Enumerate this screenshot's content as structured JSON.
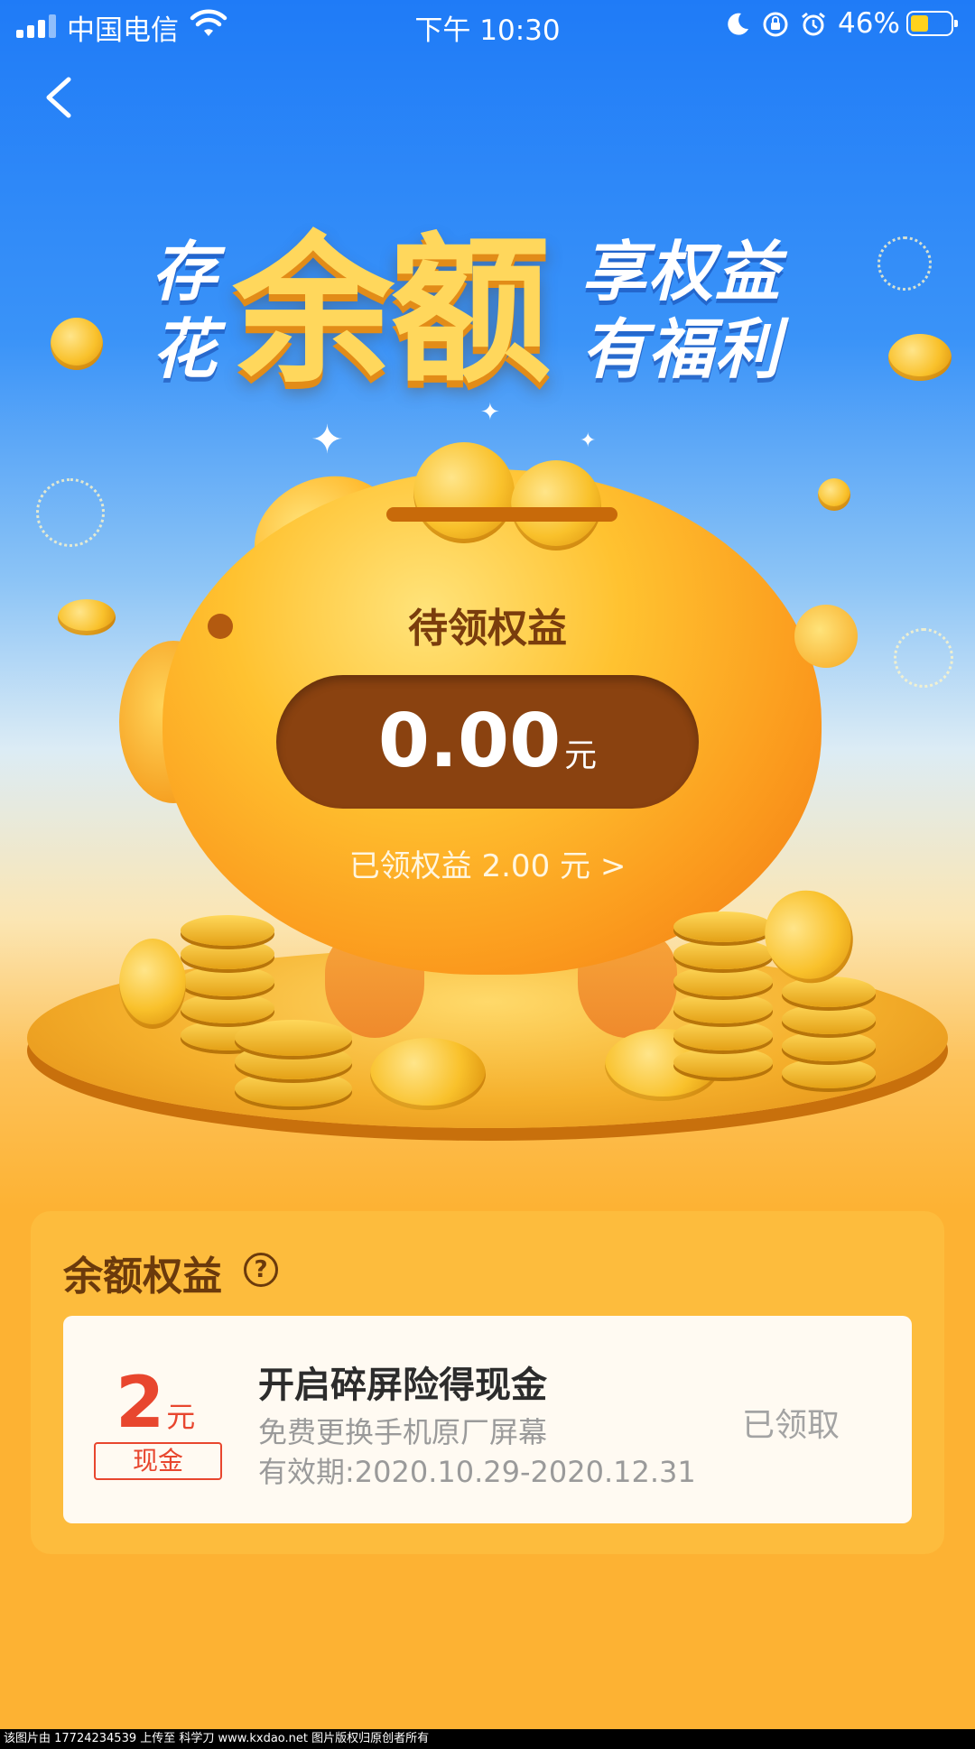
{
  "status_bar": {
    "carrier": "中国电信",
    "time": "下午 10:30",
    "battery_percent": "46%",
    "battery_level": 0.46,
    "battery_color": "#ffd21d",
    "icons": [
      "signal-icon",
      "wifi-icon",
      "moon-icon",
      "orientation-lock-icon",
      "alarm-icon",
      "battery-icon"
    ]
  },
  "nav": {
    "back_icon": "chevron-left-icon"
  },
  "headline": {
    "left_top": "存",
    "left_bottom": "花",
    "big": "余额",
    "right_top": "享权益",
    "right_bottom": "有福利"
  },
  "pending": {
    "title": "待领权益",
    "amount": "0.00",
    "unit": "元"
  },
  "claimed_link": "已领权益 2.00 元 >",
  "benefits": {
    "title": "余额权益",
    "help_glyph": "?",
    "items": [
      {
        "amount": "2",
        "unit": "元",
        "tag": "现金",
        "title": "开启碎屏险得现金",
        "desc": "免费更换手机原厂屏幕",
        "validity": "有效期:2020.10.29-2020.12.31",
        "status": "已领取"
      }
    ]
  },
  "footer": "该图片由 17724234539 上传至 科学刀 www.kxdao.net 图片版权归原创者所有",
  "colors": {
    "accent_blue": "#1f7bf7",
    "gold": "#fdb233",
    "brown": "#8a4210",
    "red": "#e8462e"
  }
}
